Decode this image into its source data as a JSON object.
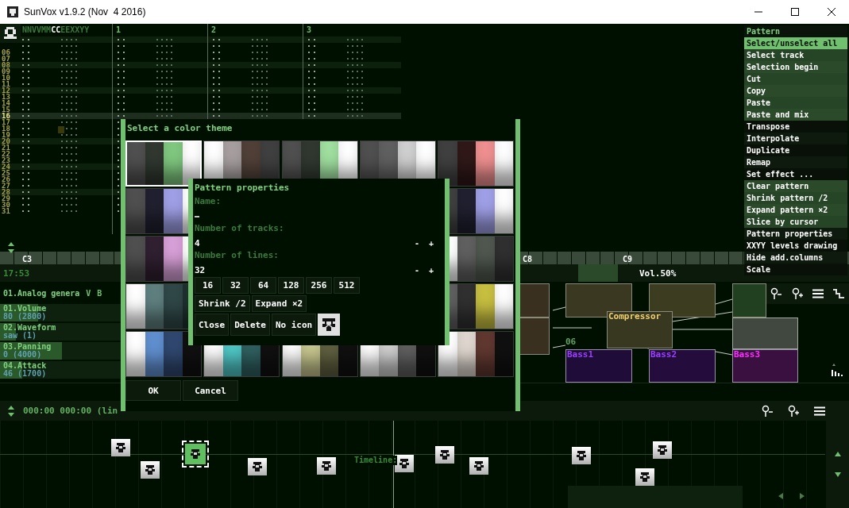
{
  "window": {
    "title": "SunVox v1.9.2 (Nov  4 2016)"
  },
  "pattern_editor": {
    "header": [
      {
        "text": "NNVVMM",
        "selected": false
      },
      {
        "text": "CC",
        "selected": true
      },
      {
        "text": "EEXXYY",
        "selected": false
      }
    ],
    "tracks": [
      "1",
      "2",
      "3"
    ],
    "rows": [
      {
        "number": "06",
        "kind": "plain"
      },
      {
        "number": "07",
        "kind": "plain"
      },
      {
        "number": "08",
        "kind": "beat"
      },
      {
        "number": "09",
        "kind": "plain"
      },
      {
        "number": "10",
        "kind": "plain"
      },
      {
        "number": "11",
        "kind": "plain"
      },
      {
        "number": "12",
        "kind": "beat"
      },
      {
        "number": "13",
        "kind": "plain"
      },
      {
        "number": "14",
        "kind": "plain"
      },
      {
        "number": "15",
        "kind": "plain"
      },
      {
        "number": "16",
        "kind": "cursor"
      },
      {
        "number": "17",
        "kind": "plain"
      },
      {
        "number": "18",
        "kind": "plain"
      },
      {
        "number": "19",
        "kind": "plain"
      },
      {
        "number": "20",
        "kind": "beat"
      },
      {
        "number": "21",
        "kind": "plain"
      },
      {
        "number": "22",
        "kind": "plain"
      },
      {
        "number": "23",
        "kind": "plain"
      },
      {
        "number": "24",
        "kind": "beat"
      },
      {
        "number": "25",
        "kind": "plain"
      },
      {
        "number": "26",
        "kind": "plain"
      },
      {
        "number": "27",
        "kind": "plain"
      },
      {
        "number": "28",
        "kind": "beat"
      },
      {
        "number": "29",
        "kind": "plain"
      },
      {
        "number": "30",
        "kind": "plain"
      },
      {
        "number": "31",
        "kind": "plain"
      }
    ]
  },
  "keyboard": {
    "labels": [
      "C3",
      "C8",
      "C9"
    ]
  },
  "menu": {
    "title": "Pattern",
    "items": [
      {
        "label": "Select/unselect all",
        "selected": true,
        "kind": "edit"
      },
      {
        "label": "Select track",
        "selected": false,
        "kind": "edit"
      },
      {
        "label": "Selection begin",
        "selected": false,
        "kind": "edit"
      },
      {
        "label": "Cut",
        "selected": false,
        "kind": "edit"
      },
      {
        "label": "Copy",
        "selected": false,
        "kind": "edit"
      },
      {
        "label": "Paste",
        "selected": false,
        "kind": "edit"
      },
      {
        "label": "Paste and mix",
        "selected": false,
        "kind": "edit"
      },
      {
        "label": "Transpose",
        "selected": false,
        "kind": "tool"
      },
      {
        "label": "Interpolate",
        "selected": false,
        "kind": "tool"
      },
      {
        "label": "Duplicate",
        "selected": false,
        "kind": "tool"
      },
      {
        "label": "Remap",
        "selected": false,
        "kind": "tool"
      },
      {
        "label": "Set effect ...",
        "selected": false,
        "kind": "tool"
      },
      {
        "label": "Clear pattern",
        "selected": false,
        "kind": "edit"
      },
      {
        "label": "Shrink pattern /2",
        "selected": false,
        "kind": "edit"
      },
      {
        "label": "Expand pattern ×2",
        "selected": false,
        "kind": "edit"
      },
      {
        "label": "Slice by cursor",
        "selected": false,
        "kind": "edit"
      },
      {
        "label": "Pattern properties",
        "selected": false,
        "kind": "tool"
      },
      {
        "label": "XXYY levels drawing",
        "selected": false,
        "kind": "tool"
      },
      {
        "label": "Hide add.columns",
        "selected": false,
        "kind": "tool"
      },
      {
        "label": "Scale",
        "selected": false,
        "kind": "tool"
      }
    ]
  },
  "module_panel": {
    "time": "17:53",
    "module": "01.Analog genera",
    "buttons": [
      "V",
      "B"
    ],
    "controllers": [
      {
        "name": "01.Volume",
        "value": "80 (2800)",
        "level": 0.31
      },
      {
        "name": "02.Waveform",
        "value": "saw (1)",
        "level": 0.13
      },
      {
        "name": "03.Panning",
        "value": "0 (4000)",
        "level": 0.5
      },
      {
        "name": "04.Attack",
        "value": "46 (1700)",
        "level": 0.18
      }
    ]
  },
  "volume_bar": {
    "label": "Vol.50%"
  },
  "module_graph": {
    "modules": [
      {
        "kind": "effect",
        "color": "#3a3020"
      },
      {
        "kind": "effect",
        "color": "#3a3020"
      },
      {
        "kind": "effect",
        "color": "#3a3820"
      },
      {
        "kind": "effect",
        "color": "#3c3c20"
      },
      {
        "kind": "effect",
        "color": "#204020"
      },
      {
        "kind": "output",
        "color": "#404840"
      },
      {
        "kind": "synth",
        "color": "#200c38",
        "name": "Bass1"
      },
      {
        "kind": "synth",
        "color": "#240c3c",
        "name": "Bass2"
      },
      {
        "kind": "sampler",
        "color": "#3a1040",
        "name": "Bass3"
      },
      {
        "kind": "effect",
        "color": "#383820",
        "name": "Compressor"
      }
    ],
    "labels": [
      "06"
    ]
  },
  "timeline": {
    "position": "000:00 000:00 (lin",
    "label": "Timeline:",
    "patterns": [
      {
        "selected": false
      },
      {
        "selected": false
      },
      {
        "selected": true
      },
      {
        "selected": false
      },
      {
        "selected": false
      },
      {
        "selected": false
      },
      {
        "selected": false
      },
      {
        "selected": false
      },
      {
        "selected": false
      },
      {
        "selected": false
      },
      {
        "selected": false
      }
    ]
  },
  "color_dialog": {
    "title": "Select a color theme",
    "theme_rows": [
      [
        {
          "selected": true,
          "stripes": [
            {
              "color": "#505050"
            },
            {
              "color": "#303830"
            },
            {
              "color": "#80c880"
            },
            {
              "color": "#ffffff"
            }
          ]
        },
        {
          "selected": false,
          "stripes": [
            {
              "color": "#ffffff"
            },
            {
              "color": "#a8a0a0"
            },
            {
              "color": "#504038"
            },
            {
              "color": "#404040"
            }
          ]
        },
        {
          "selected": false,
          "stripes": [
            {
              "color": "#505050"
            },
            {
              "color": "#303830"
            },
            {
              "color": "#a0e0a0"
            },
            {
              "color": "#ffffff"
            }
          ]
        },
        {
          "selected": false,
          "stripes": [
            {
              "color": "#505050"
            },
            {
              "color": "#606060"
            },
            {
              "color": "#d0d0d0"
            },
            {
              "color": "#ffffff"
            }
          ]
        },
        {
          "selected": false,
          "stripes": [
            {
              "color": "#404040"
            },
            {
              "color": "#301818"
            },
            {
              "color": "#f09090"
            },
            {
              "color": "#ffffff"
            }
          ]
        }
      ],
      [
        {
          "selected": false,
          "stripes": [
            {
              "color": "#505050"
            },
            {
              "color": "#202030"
            },
            {
              "color": "#a0a0e8"
            },
            {
              "color": "#ffffff"
            }
          ]
        },
        {
          "selected": false,
          "stripes": [
            {
              "color": "#404040"
            },
            {
              "color": "#202030"
            },
            {
              "color": "#a0a0e8"
            },
            {
              "color": "#ffffff"
            }
          ]
        }
      ],
      [
        {
          "selected": false,
          "stripes": [
            {
              "color": "#505050"
            },
            {
              "color": "#302030"
            },
            {
              "color": "#d8a0d8"
            },
            {
              "color": "#ffffff"
            }
          ]
        },
        {
          "selected": false,
          "stripes": [
            {
              "color": "#ffffff"
            },
            {
              "color": "#606060"
            },
            {
              "color": "#505850"
            },
            {
              "color": "#303030"
            }
          ]
        }
      ],
      [
        {
          "selected": false,
          "stripes": [
            {
              "color": "#ffffff"
            },
            {
              "color": "#608080"
            },
            {
              "color": "#304848"
            },
            {
              "color": "#203030"
            }
          ]
        },
        {
          "selected": false,
          "stripes": [
            {
              "color": "#606060"
            },
            {
              "color": "#303030"
            },
            {
              "color": "#c8c040"
            },
            {
              "color": "#ffffff"
            }
          ]
        }
      ],
      [
        {
          "selected": false,
          "stripes": [
            {
              "color": "#ffffff"
            },
            {
              "color": "#6090d0"
            },
            {
              "color": "#304870"
            },
            {
              "color": "#101010"
            }
          ]
        },
        {
          "selected": false,
          "stripes": [
            {
              "color": "#ffffff"
            },
            {
              "color": "#50c8c8"
            },
            {
              "color": "#306060"
            },
            {
              "color": "#101010"
            }
          ]
        },
        {
          "selected": false,
          "stripes": [
            {
              "color": "#ffffff"
            },
            {
              "color": "#c8c890"
            },
            {
              "color": "#606040"
            },
            {
              "color": "#101010"
            }
          ]
        },
        {
          "selected": false,
          "stripes": [
            {
              "color": "#ffffff"
            },
            {
              "color": "#d0d0d0"
            },
            {
              "color": "#606060"
            },
            {
              "color": "#101010"
            }
          ]
        },
        {
          "selected": false,
          "stripes": [
            {
              "color": "#ffffff"
            },
            {
              "color": "#e0d8d0"
            },
            {
              "color": "#603830"
            },
            {
              "color": "#101010"
            }
          ]
        }
      ]
    ],
    "buttons": [
      "OK",
      "Cancel"
    ]
  },
  "pattern_dialog": {
    "title": "Pattern properties",
    "name_label": "Name:",
    "name_value": "…",
    "tracks_label": "Number of tracks:",
    "tracks_value": "4",
    "tracks_buttons": [
      "-",
      "+"
    ],
    "lines_label": "Number of lines:",
    "lines_value": "32",
    "lines_buttons": [
      "-",
      "+"
    ],
    "line_presets": [
      "16",
      "32",
      "64",
      "128",
      "256",
      "512"
    ],
    "resize_buttons": [
      "Shrink /2",
      "Expand ×2"
    ],
    "action_buttons": [
      "Close",
      "Delete",
      "No icon"
    ]
  }
}
